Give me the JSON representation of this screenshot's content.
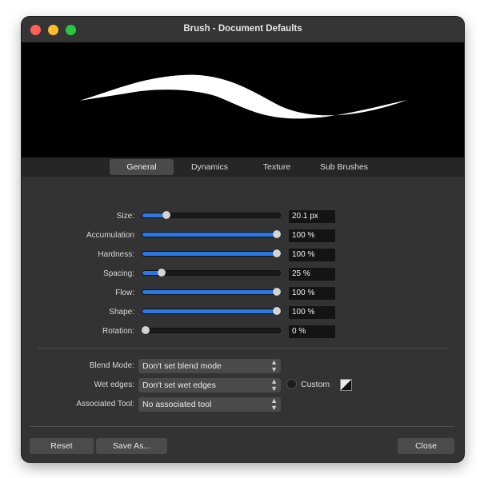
{
  "window": {
    "title": "Brush - Document Defaults"
  },
  "tabs": [
    {
      "label": "General",
      "active": true
    },
    {
      "label": "Dynamics",
      "active": false
    },
    {
      "label": "Texture",
      "active": false
    },
    {
      "label": "Sub Brushes",
      "active": false
    }
  ],
  "sliders": [
    {
      "label": "Size:",
      "value": "20.1 px",
      "level": 0.16
    },
    {
      "label": "Accumulation",
      "value": "100 %",
      "level": 1.0
    },
    {
      "label": "Hardness:",
      "value": "100 %",
      "level": 1.0
    },
    {
      "label": "Spacing:",
      "value": "25 %",
      "level": 0.12
    },
    {
      "label": "Flow:",
      "value": "100 %",
      "level": 1.0
    },
    {
      "label": "Shape:",
      "value": "100 %",
      "level": 1.0
    },
    {
      "label": "Rotation:",
      "value": "0 %",
      "level": 0.0
    }
  ],
  "options": {
    "blend_mode": {
      "label": "Blend Mode:",
      "value": "Don't set blend mode"
    },
    "wet_edges": {
      "label": "Wet edges:",
      "value": "Don't set wet edges"
    },
    "associated_tool": {
      "label": "Associated Tool:",
      "value": "No associated tool"
    },
    "custom_label": "Custom"
  },
  "buttons": {
    "reset": "Reset",
    "save_as": "Save As...",
    "close": "Close"
  },
  "colors": {
    "accent": "#2a78e4",
    "background": "#333333",
    "preview_bg": "#000000"
  }
}
